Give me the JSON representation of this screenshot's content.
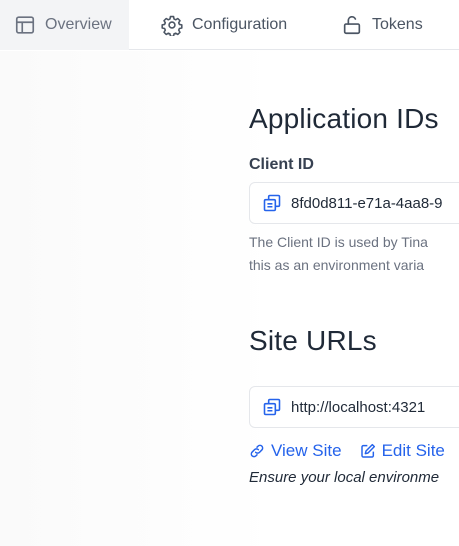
{
  "tabs": [
    {
      "label": "Overview",
      "icon": "layout-icon",
      "active": true
    },
    {
      "label": "Configuration",
      "icon": "gear-icon",
      "active": false
    },
    {
      "label": "Tokens",
      "icon": "unlock-icon",
      "active": false
    }
  ],
  "application_ids": {
    "heading": "Application IDs",
    "client_id_label": "Client ID",
    "client_id_value": "8fd0d811-e71a-4aa8-9",
    "help_line1": "The Client ID is used by Tina",
    "help_line2": "this as an environment varia"
  },
  "site_urls": {
    "heading": "Site URLs",
    "url_value": "http://localhost:4321",
    "view_site_label": "View Site",
    "edit_site_label": "Edit Site",
    "note": "Ensure your local environme"
  },
  "colors": {
    "link": "#2563eb",
    "muted_text": "#6b7280",
    "active_tab_bg": "#f3f4f6"
  }
}
